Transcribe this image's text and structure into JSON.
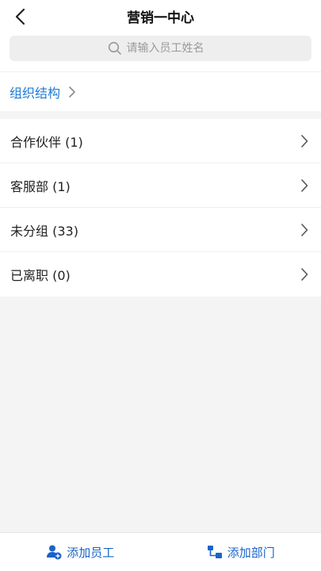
{
  "header": {
    "title": "营销一中心",
    "back_icon": "chevron-left-icon"
  },
  "search": {
    "placeholder": "请输入员工姓名",
    "value": "",
    "icon": "search-icon"
  },
  "org": {
    "label": "组织结构",
    "icon": "chevron-right-icon"
  },
  "departments": [
    {
      "label": "合作伙伴 (1)"
    },
    {
      "label": "客服部 (1)"
    },
    {
      "label": "未分组 (33)"
    },
    {
      "label": "已离职 (0)"
    }
  ],
  "bottom_bar": {
    "add_employee_label": "添加员工",
    "add_employee_icon": "add-user-icon",
    "add_department_label": "添加部门",
    "add_department_icon": "org-chart-icon"
  },
  "colors": {
    "accent": "#1e7ad6",
    "bottom_accent": "#1a63c9",
    "background": "#f4f4f4"
  }
}
